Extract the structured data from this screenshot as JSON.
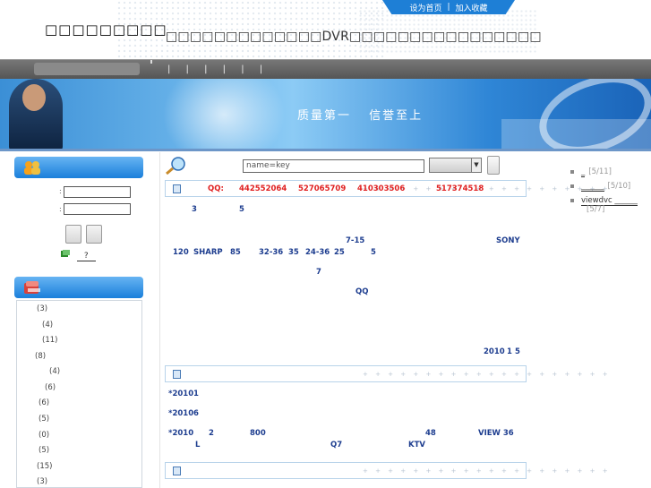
{
  "header": {
    "logo_text": "□□□□□□□□□",
    "slogan": "□□□□□□□□□□□□□DVR□□□□□□□□□□□□□□□□",
    "toplinks": [
      "设为首页",
      "|",
      "加入收藏"
    ]
  },
  "nav": {
    "separators": "| | | | | |"
  },
  "banner": {
    "text_1": "质量第一",
    "text_2": "信誉至上"
  },
  "search": {
    "placeholder": "name=key"
  },
  "login": {
    "label_1": ":",
    "label_2": ":",
    "help_prefix": "",
    "help_link": "?"
  },
  "categories": [
    {
      "label": "(3)"
    },
    {
      "label": "(4)"
    },
    {
      "label": "(11)"
    },
    {
      "label": "(8)"
    },
    {
      "label": "(4)"
    },
    {
      "label": "(6)"
    },
    {
      "label": "(6)"
    },
    {
      "label": "(5)"
    },
    {
      "label": "(0)"
    },
    {
      "label": "(5)"
    },
    {
      "label": "(15)"
    },
    {
      "label": "(3)"
    }
  ],
  "qq": {
    "label": "QQ:",
    "numbers": [
      "442552064",
      "527065709",
      "410303506",
      "517374518"
    ]
  },
  "intro": [
    {
      "text": "3"
    },
    {
      "text": "5"
    },
    {
      "text": "7-15"
    },
    {
      "text": "SONY"
    },
    {
      "text": "120"
    },
    {
      "text": "SHARP"
    },
    {
      "text": "85"
    },
    {
      "text": "32-36"
    },
    {
      "text": "35"
    },
    {
      "text": "24-36"
    },
    {
      "text": "25"
    },
    {
      "text": "5"
    },
    {
      "text": "7"
    },
    {
      "text": "QQ"
    },
    {
      "text": "2010"
    },
    {
      "text": "1"
    },
    {
      "text": "5"
    }
  ],
  "news": [
    {
      "text": "*2010"
    },
    {
      "text": "1"
    },
    {
      "text": "*2010"
    },
    {
      "text": "6"
    },
    {
      "text": "*2010"
    },
    {
      "text": "2"
    },
    {
      "text": "800"
    },
    {
      "text": "48"
    },
    {
      "text": "VIEW 36"
    },
    {
      "text": "L"
    },
    {
      "text": "Q7"
    },
    {
      "text": "KTV"
    }
  ],
  "sidebar_right": [
    {
      "link": "_",
      "date": "[5/11]"
    },
    {
      "link": "______",
      "date": "[5/10]"
    },
    {
      "link": "viewdvc ______",
      "date": "[5/7]"
    }
  ],
  "section_plus": "+ + + + + + + + + + + + + + + + + + + +",
  "colors": {
    "accent_blue": "#1e7fd6",
    "qq_red": "#e02020",
    "text_blue": "#1d3d8f"
  }
}
